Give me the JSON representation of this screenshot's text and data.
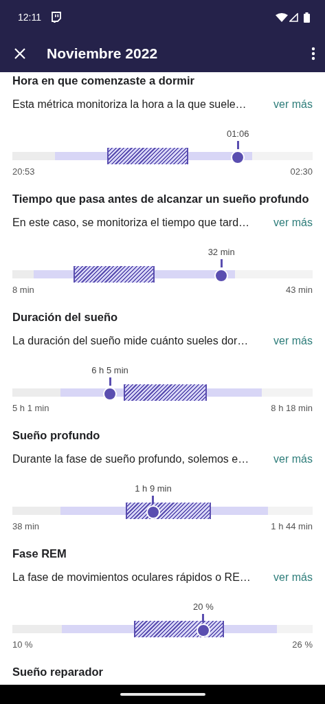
{
  "status_bar": {
    "time": "12:11"
  },
  "toolbar": {
    "title": "Noviembre 2022"
  },
  "sections": [
    {
      "title": "Hora en que comenzaste a dormir",
      "description": "Esta métrica monitoriza la hora a la que suele…",
      "link": "ver más",
      "chart": {
        "marker": {
          "label": "01:06",
          "level": 0.751
        },
        "range": {
          "start": {
            "level": 0.142
          },
          "end": {
            "level": 0.799
          }
        },
        "typical": {
          "start": {
            "level": 0.318
          },
          "end": {
            "level": 0.584
          }
        },
        "min_label": "20:53",
        "max_label": "02:30"
      }
    },
    {
      "title": "Tiempo que pasa antes de alcanzar un sueño profundo",
      "description": "En este caso, se monitoriza el tiempo que tard…",
      "link": "ver más",
      "chart": {
        "marker": {
          "label": "32 min",
          "level": 0.696
        },
        "range": {
          "start": {
            "level": 0.071
          },
          "end": {
            "level": 0.741
          }
        },
        "typical": {
          "start": {
            "level": 0.206
          },
          "end": {
            "level": 0.471
          }
        },
        "min_label": "8 min",
        "max_label": "43 min"
      }
    },
    {
      "title": "Duración del sueño",
      "description": "La duración del sueño mide cuánto sueles dor…",
      "link": "ver más",
      "chart": {
        "marker": {
          "label": "6 h 5 min",
          "level": 0.325
        },
        "range": {
          "start": {
            "level": 0.16
          },
          "end": {
            "level": 0.831
          }
        },
        "typical": {
          "start": {
            "level": 0.373
          },
          "end": {
            "level": 0.645
          }
        },
        "min_label": "5 h 1 min",
        "max_label": "8 h 18 min"
      }
    },
    {
      "title": "Sueño profundo",
      "description": "Durante la fase de sueño profundo, solemos e…",
      "link": "ver más",
      "chart": {
        "marker": {
          "label": "1 h 9 min",
          "level": 0.469
        },
        "range": {
          "start": {
            "level": 0.16
          },
          "end": {
            "level": 0.851
          }
        },
        "typical": {
          "start": {
            "level": 0.38
          },
          "end": {
            "level": 0.659
          }
        },
        "min_label": "38 min",
        "max_label": "1 h 44 min"
      }
    },
    {
      "title": "Fase REM",
      "description": "La fase de movimientos oculares rápidos o RE…",
      "link": "ver más",
      "chart": {
        "marker": {
          "label": "20 %",
          "level": 0.636
        },
        "range": {
          "start": {
            "level": 0.165
          },
          "end": {
            "level": 0.881
          }
        },
        "typical": {
          "start": {
            "level": 0.407
          },
          "end": {
            "level": 0.703
          }
        },
        "min_label": "10 %",
        "max_label": "26 %"
      }
    },
    {
      "title": "Sueño reparador"
    }
  ]
}
